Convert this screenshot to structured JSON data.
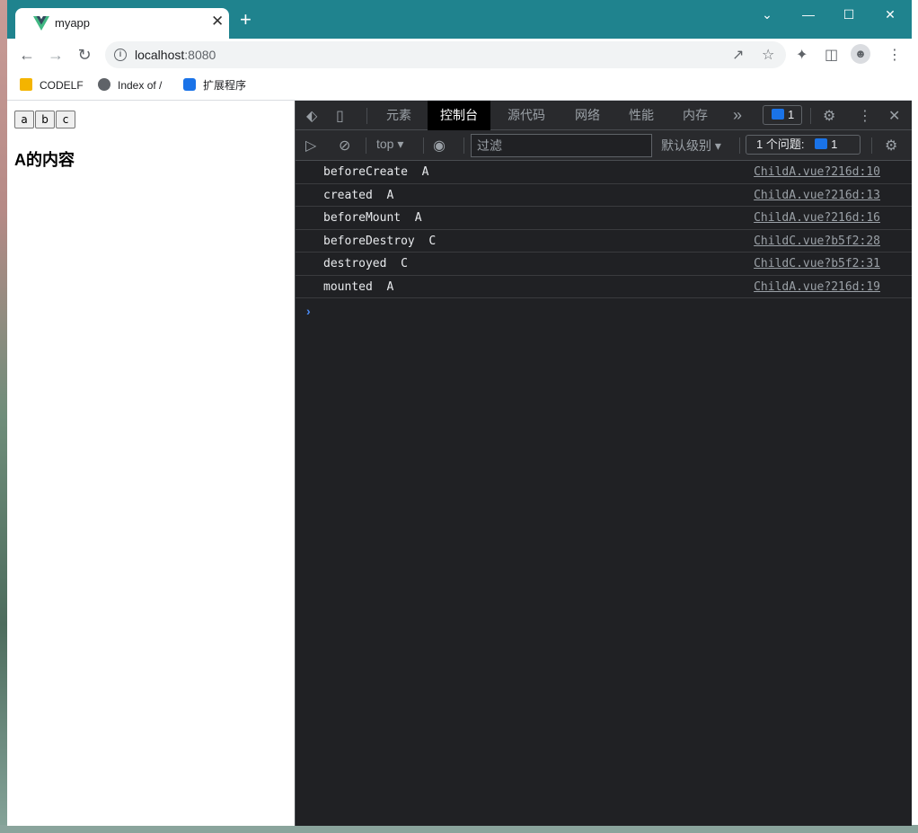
{
  "browser": {
    "tab_title": "myapp",
    "tab_close": "✕",
    "new_tab": "+",
    "window_controls": {
      "dropdown": "⌄",
      "minimize": "—",
      "maximize": "☐",
      "close": "✕"
    },
    "url_host": "localhost",
    "url_port": ":8080",
    "bookmarks": [
      {
        "label": "CODELF",
        "icon": "codelf-icon"
      },
      {
        "label": "Index of /",
        "icon": "globe-icon"
      },
      {
        "label": "扩展程序",
        "icon": "puzzle-icon"
      }
    ]
  },
  "page": {
    "buttons": [
      "a",
      "b",
      "c"
    ],
    "heading": "A的内容"
  },
  "devtools": {
    "tabs": [
      "元素",
      "控制台",
      "源代码",
      "网络",
      "性能",
      "内存"
    ],
    "active_tab": "控制台",
    "more_tabs": "»",
    "issues_badge": "1",
    "context": "top",
    "filter_placeholder": "过滤",
    "level": "默认级别",
    "issues_label": "1 个问题:",
    "issues_count": "1",
    "logs": [
      {
        "message": "beforeCreate  A",
        "source": "ChildA.vue?216d:10"
      },
      {
        "message": "created  A",
        "source": "ChildA.vue?216d:13"
      },
      {
        "message": "beforeMount  A",
        "source": "ChildA.vue?216d:16"
      },
      {
        "message": "beforeDestroy  C",
        "source": "ChildC.vue?b5f2:28"
      },
      {
        "message": "destroyed  C",
        "source": "ChildC.vue?b5f2:31"
      },
      {
        "message": "mounted  A",
        "source": "ChildA.vue?216d:19"
      }
    ],
    "prompt": "›"
  },
  "colors": {
    "titlebar": "#1f838e",
    "devtools_bg": "#202124",
    "accent_blue": "#1a73e8"
  }
}
